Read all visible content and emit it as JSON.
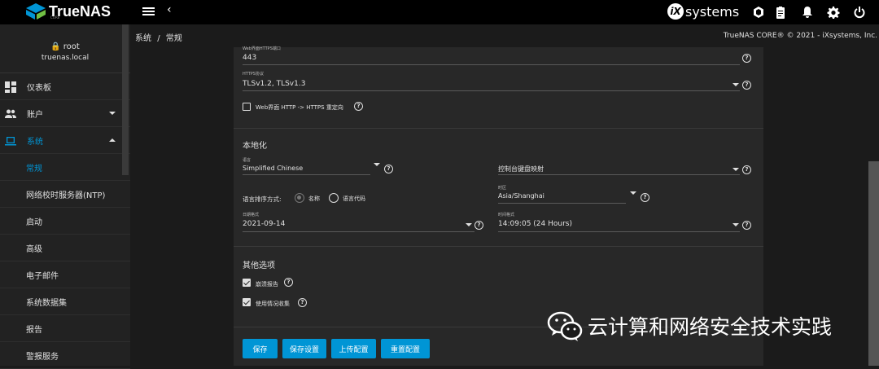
{
  "topbar": {
    "brand": "TrueNAS",
    "brand_sub": "CORE",
    "ix_letter": "iX",
    "ix_text": "systems"
  },
  "sidebar": {
    "user": "root",
    "host": "truenas.local",
    "items": [
      {
        "label": "仪表板"
      },
      {
        "label": "账户"
      },
      {
        "label": "系统"
      },
      {
        "label": "常规"
      },
      {
        "label": "网络校时服务器(NTP)"
      },
      {
        "label": "启动"
      },
      {
        "label": "高级"
      },
      {
        "label": "电子邮件"
      },
      {
        "label": "系统数据集"
      },
      {
        "label": "报告"
      },
      {
        "label": "警报服务"
      }
    ]
  },
  "breadcrumb": {
    "part1": "系统",
    "sep": "/",
    "part2": "常规"
  },
  "copyright": "TrueNAS CORE® © 2021 - iXsystems, Inc.",
  "form": {
    "https_port": {
      "label": "Web界面HTTPS端口",
      "value": "443"
    },
    "https_protocols": {
      "label": "HTTPS协议",
      "value": "TLSv1.2, TLSv1.3"
    },
    "redirect": {
      "label": "Web界面 HTTP -> HTTPS 重定向",
      "checked": false
    },
    "localization_title": "本地化",
    "language": {
      "label": "语言",
      "value": "Simplified Chinese"
    },
    "console_keyboard": {
      "label": "控制台键盘映射",
      "value": ""
    },
    "lang_sort": {
      "label": "语言排序方式:",
      "opt1": "名称",
      "opt2": "语言代码"
    },
    "timezone": {
      "label": "时区",
      "value": "Asia/Shanghai"
    },
    "date_format": {
      "label": "日期格式",
      "value": "2021-09-14"
    },
    "time_format": {
      "label": "时间格式",
      "value": "14:09:05 (24 Hours)"
    },
    "other_title": "其他选项",
    "crash_report": {
      "label": "崩溃报告",
      "checked": true
    },
    "usage_collection": {
      "label": "使用情况收集",
      "checked": true
    }
  },
  "buttons": {
    "save": "保存",
    "save_config": "保存设置",
    "upload_config": "上传配置",
    "reset_config": "重置配置"
  },
  "watermark": "云计算和网络安全技术实践",
  "colors": {
    "accent": "#0095d5",
    "topbar": "#000000",
    "card": "#282828"
  }
}
